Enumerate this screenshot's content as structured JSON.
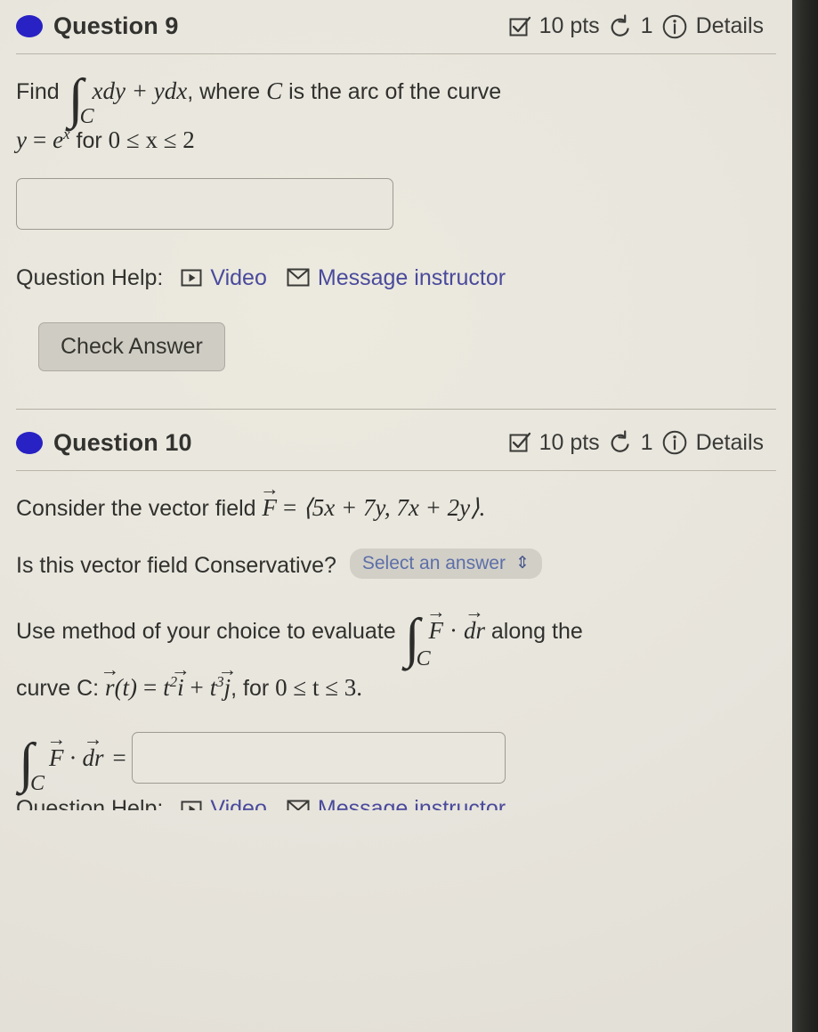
{
  "questions": [
    {
      "id": "q9",
      "title": "Question 9",
      "points": "10 pts",
      "attempts": "1",
      "details_label": "Details",
      "prompt_lead": "Find",
      "integral_limit": "C",
      "integrand": "xdy + ydx",
      "prompt_mid": ", where",
      "curve_var": "C",
      "prompt_tail": "is the arc of the curve",
      "curve_eq_lhs": "y",
      "curve_eq_eq": "=",
      "curve_eq_base": "e",
      "curve_eq_exp": "x",
      "curve_eq_for": "for",
      "curve_domain": "0 ≤ x ≤ 2",
      "answer_value": "",
      "answer_placeholder": "",
      "help_label": "Question Help:",
      "video_label": "Video",
      "message_label": "Message instructor",
      "check_label": "Check Answer"
    },
    {
      "id": "q10",
      "title": "Question 10",
      "points": "10 pts",
      "attempts": "1",
      "details_label": "Details",
      "vf_lead": "Consider the vector field",
      "vf_symbol": "F",
      "vf_equals": "=",
      "vf_value": "⟨5x + 7y, 7x + 2y⟩.",
      "conservative_question": "Is this vector field Conservative?",
      "select_label": "Select an answer",
      "select_chevron": "⇕",
      "method_lead": "Use method of your choice to evaluate",
      "method_integral_limit": "C",
      "method_integrand_f": "F",
      "method_integrand_dot": "·",
      "method_integrand_dr": "dr",
      "method_tail": "along the",
      "curve_lead": "curve C:",
      "curve_r": "r",
      "curve_of_t": "(t)",
      "curve_eq": "=",
      "curve_t2": "t",
      "curve_t2_exp": "2",
      "curve_i": "i",
      "curve_plus": "+",
      "curve_t3": "t",
      "curve_t3_exp": "3",
      "curve_j": "j",
      "curve_for": ", for",
      "curve_domain": "0 ≤ t ≤ 3.",
      "answer_lhs_f": "F",
      "answer_lhs_dot": "·",
      "answer_lhs_dr": "dr",
      "answer_lhs_limit": "C",
      "answer_equals": "=",
      "answer_value": "",
      "answer_placeholder": "",
      "help_label": "Question Help:",
      "video_label": "Video",
      "message_label": "Message instructor"
    }
  ],
  "icons": {
    "points_checkbox": "checkbox-check-icon",
    "attempts_retry": "retry-arrow-icon",
    "details_info": "info-circle-icon",
    "video": "video-play-icon",
    "message": "envelope-icon",
    "status": "status-dot-icon"
  },
  "colors": {
    "page_background": "#e8e5dd",
    "status_dot": "#2821c4",
    "link": "#4a4a9c",
    "select_text": "#5c6fa8",
    "select_background": "#d2cfc7",
    "button_background": "#cfccc4",
    "divider": "#b9b5ab",
    "text": "#2e2e2c"
  }
}
